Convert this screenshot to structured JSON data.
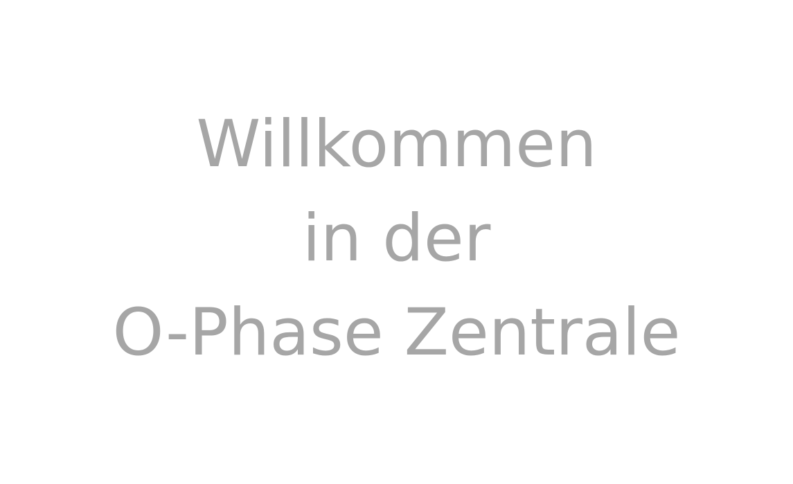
{
  "welcome": {
    "lines": [
      "Willkommen",
      "in der",
      "O-Phase Zentrale"
    ],
    "text_color": "#a6a6a6",
    "background_color": "#ffffff"
  }
}
